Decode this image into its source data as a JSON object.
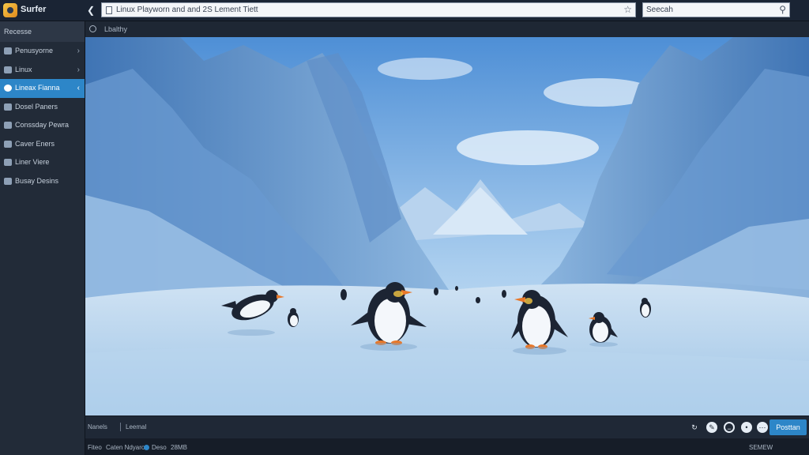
{
  "app": {
    "title": "Surfer"
  },
  "address_bar": {
    "url": "Linux Playworn and and 2S Lement Tiett"
  },
  "search": {
    "placeholder": "Seecah"
  },
  "sidebar": {
    "heading": "Recesse",
    "items": [
      {
        "label": "Penusyorne",
        "icon": "box-icon",
        "active": false
      },
      {
        "label": "Linux",
        "icon": "folder-icon",
        "active": false
      },
      {
        "label": "Lineax Fianna",
        "icon": "gear-icon",
        "active": true
      },
      {
        "label": "Dosel Paners",
        "icon": "document-icon",
        "active": false
      },
      {
        "label": "Conssday Pewra",
        "icon": "window-icon",
        "active": false
      },
      {
        "label": "Caver Eners",
        "icon": "terminal-icon",
        "active": false
      },
      {
        "label": "Liner Viere",
        "icon": "disk-icon",
        "active": false
      },
      {
        "label": "Busay Desins",
        "icon": "image-icon",
        "active": false
      }
    ]
  },
  "toolbar": {
    "breadcrumb": "Lbalthy"
  },
  "controls": {
    "left_label": "Nanels",
    "right_label": "Leemal",
    "primary_button": "Posttan"
  },
  "status": {
    "left": "Fiteo",
    "item2": "Caten Ndyaro",
    "item3": "Deso",
    "item4": "28MB",
    "right": "SEMEW"
  },
  "colors": {
    "accent": "#2d86c8",
    "sidebar_bg": "#222b38",
    "topbar_bg": "#1a2434"
  }
}
